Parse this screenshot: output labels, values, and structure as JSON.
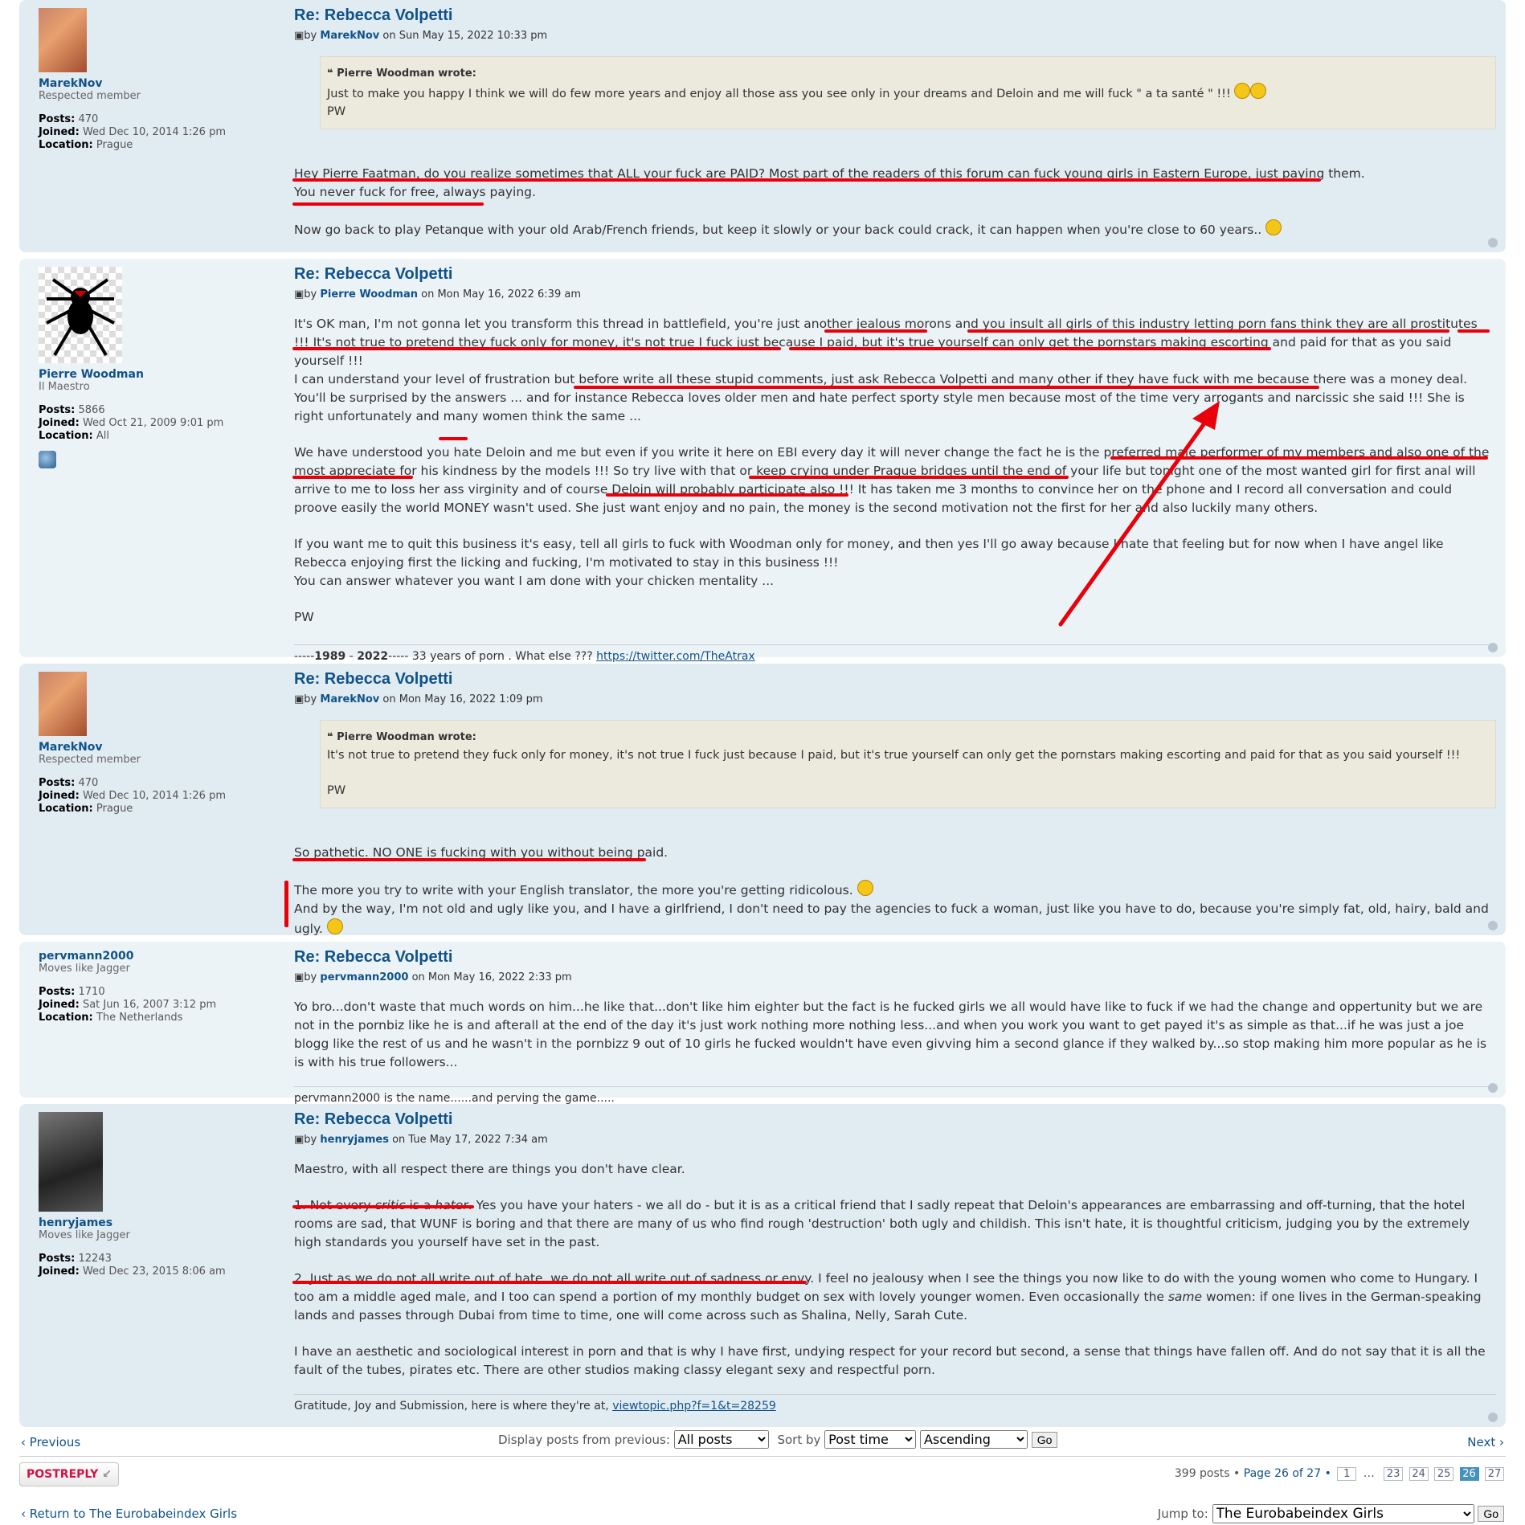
{
  "posts": [
    {
      "author": "MarekNov",
      "rank": "Respected member",
      "posts_label": "Posts:",
      "posts": "470",
      "joined_label": "Joined:",
      "joined": "Wed Dec 10, 2014 1:26 pm",
      "location_label": "Location:",
      "location": "Prague",
      "title": "Re: Rebecca Volpetti",
      "by": "by",
      "date": "on Sun May 15, 2022 10:33 pm",
      "quote_cite": "Pierre Woodman wrote:",
      "quote_text": "Just to make you happy I think we will do few more years and enjoy all those ass you see only in your dreams and Deloin and me will fuck \" a ta santé \" !!!",
      "quote_sign": "PW",
      "p1": "Hey Pierre Faatman, do you realize sometimes that ALL your fuck are PAID? Most part of the readers of this forum can fuck young girls in Eastern Europe, just paying them.",
      "p1b": "You never fuck for free, always paying.",
      "p2": "Now go back to play Petanque with your old Arab/French friends, but keep it slowly or your back could crack, it can happen when you're close to 60 years.."
    },
    {
      "author": "Pierre Woodman",
      "rank": "Il Maestro",
      "posts_label": "Posts:",
      "posts": "5866",
      "joined_label": "Joined:",
      "joined": "Wed Oct 21, 2009 9:01 pm",
      "location_label": "Location:",
      "location": "All",
      "title": "Re: Rebecca Volpetti",
      "by": "by",
      "date": "on Mon May 16, 2022 6:39 am",
      "p1": "It's OK man, I'm not gonna let you transform this thread in battlefield, you're just another jealous morons and you insult all girls of this industry letting porn fans think they are all prostitutes !!! It's not true to pretend they fuck only for money, it's not true I fuck just because I paid, but it's true yourself can only get the pornstars making escorting and paid for that as you said yourself !!!",
      "p1b": "I can understand your level of frustration but before write all these stupid comments, just ask Rebecca Volpetti and many other if they have fuck with me because there was a money deal. You'll be surprised by the answers ... and for instance Rebecca loves older men and hate perfect sporty style men because most of the time very arrogants and narcissic she said !!! She is right unfortunately and many women think the same ...",
      "p2": "We have understood you hate Deloin and me but even if you write it here on EBI every day it will never change the fact he is the preferred male performer of my members and also one of the most appreciate for his kindness by the models !!! So try live with that or keep crying under Prague bridges until the end of your life but tonight one of the most wanted girl for first anal will arrive to me to loss her ass virginity and of course Deloin will probably participate also !!! It has taken me 3 months to convince her on the phone and I record all conversation and could proove easily the world MONEY wasn't used. She just want enjoy and no pain, the money is the second motivation not the first for her and also luckily many others.",
      "p3": "If you want me to quit this business it's easy, tell all girls to fuck with Woodman only for money, and then yes I'll go away because I hate that feeling but for now when I have angel like Rebecca enjoying first the licking and fucking, I'm motivated to stay in this business !!!",
      "p3b": "You can answer whatever you want I am done with your chicken mentality ...",
      "p4": "PW",
      "sig_pre": "-----",
      "sig_y1": "1989",
      "sig_mid": " - ",
      "sig_y2": "2022",
      "sig_post": "----- 33 years of porn . What else ??? ",
      "sig_link": "https://twitter.com/TheAtrax"
    },
    {
      "author": "MarekNov",
      "rank": "Respected member",
      "posts_label": "Posts:",
      "posts": "470",
      "joined_label": "Joined:",
      "joined": "Wed Dec 10, 2014 1:26 pm",
      "location_label": "Location:",
      "location": "Prague",
      "title": "Re: Rebecca Volpetti",
      "by": "by",
      "date": "on Mon May 16, 2022 1:09 pm",
      "quote_cite": "Pierre Woodman wrote:",
      "quote_text": "It's not true to pretend they fuck only for money, it's not true I fuck just because I paid, but it's true yourself can only get the pornstars making escorting and paid for that as you said yourself !!!",
      "quote_sign": "PW",
      "p1": "So pathetic. NO ONE is fucking with you without being paid.",
      "p2": "The more you try to write with your English translator, the more you're getting ridicolous.",
      "p2b": "And by the way, I'm not old and ugly like you, and I have a girlfriend, I don't need to pay the agencies to fuck a woman, just like you have to do, because you're simply fat, old, hairy, bald and ugly."
    },
    {
      "author": "pervmann2000",
      "rank": "Moves like Jagger",
      "posts_label": "Posts:",
      "posts": "1710",
      "joined_label": "Joined:",
      "joined": "Sat Jun 16, 2007 3:12 pm",
      "location_label": "Location:",
      "location": "The Netherlands",
      "title": "Re: Rebecca Volpetti",
      "by": "by",
      "date": "on Mon May 16, 2022 2:33 pm",
      "p1": "Yo bro...don't waste that much words on him...he like that...don't like him eighter but the fact is he fucked girls we all would have like to fuck if we had the change and oppertunity but we are not in the pornbiz like he is and afterall at the end of the day it's just work nothing more nothing less...and when you work you want to get payed it's as simple as that...if he was just a joe blogg like the rest of us and he wasn't in the pornbizz 9 out of 10 girls he fucked wouldn't have even givving him a second glance if they walked by...so stop making him more popular as he is is with his true followers...",
      "sig": "pervmann2000 is the name......and perving the game....."
    },
    {
      "author": "henryjames",
      "rank": "Moves like Jagger",
      "posts_label": "Posts:",
      "posts": "12243",
      "joined_label": "Joined:",
      "joined": "Wed Dec 23, 2015 8:06 am",
      "title": "Re: Rebecca Volpetti",
      "by": "by",
      "date": "on Tue May 17, 2022 7:34 am",
      "p1": "Maestro, with all respect there are things you don't have clear.",
      "p2_a": "1. Not every ",
      "p2_b": "critic",
      "p2_c": " is a ",
      "p2_d": "hater",
      "p2_e": ". Yes you have your haters - we all do - but it is as a critical friend that I sadly repeat that Deloin's appearances are embarrassing and off-turning, that the hotel rooms are sad, that WUNF is boring and that there are many of us who find rough 'destruction' both ugly and childish. This isn't hate, it is thoughtful criticism, judging you by the extremely high standards you yourself have set in the past.",
      "p3_a": "2. Just as we do not all write out of hate, we do not all write out of sadness or envy. I feel no jealousy when I see the things you now like to do with the young women who come to Hungary. I too am a middle aged male, and I too can spend a portion of my monthly budget on sex with lovely younger women. Even occasionally the ",
      "p3_b": "same",
      "p3_c": " women: if one lives in the German-speaking lands and passes through Dubai from time to time, one will come across such as Shalina, Nelly, Sarah Cute.",
      "p4": "I have an aesthetic and sociological interest in porn and that is why I have first, undying respect for your record but second, a sense that things have fallen off. And do not say that it is all the fault of the tubes, pirates etc. There are other studios making classy elegant sexy and respectful porn.",
      "sig_text": "Gratitude, Joy and Submission, here is where they're at, ",
      "sig_link": "viewtopic.php?f=1&t=28259"
    }
  ],
  "nav": {
    "previous": "Previous",
    "next": "Next",
    "display_label": "Display posts from previous:",
    "display_value": "All posts",
    "sort_label": "Sort by",
    "sort_value": "Post time",
    "order_value": "Ascending",
    "go": "Go"
  },
  "footer": {
    "postreply": "POSTREPLY",
    "posts_count": "399 posts •",
    "page_text": "Page 26 of 27 •",
    "pages": [
      "1",
      "…",
      "23",
      "24",
      "25",
      "26",
      "27"
    ],
    "active_page": "26",
    "return_link": "Return to The Eurobabeindex Girls",
    "jump_label": "Jump to:",
    "jump_value": "The Eurobabeindex Girls",
    "go": "Go"
  },
  "colors": {
    "link": "#105289",
    "annotation": "#e8000b",
    "post_bg_a": "#e1ebf2",
    "post_bg_b": "#ecf3f7"
  }
}
